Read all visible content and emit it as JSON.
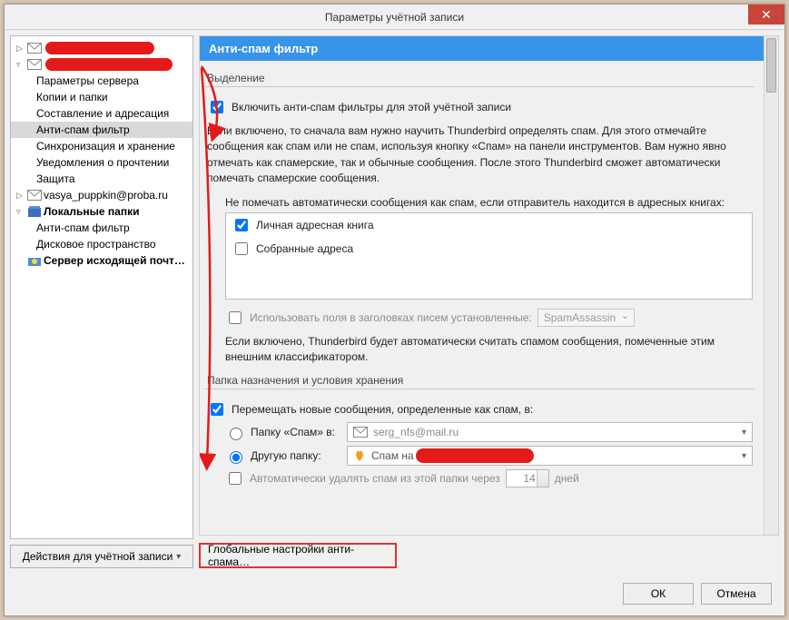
{
  "window": {
    "title": "Параметры учётной записи"
  },
  "tree": {
    "account1": "",
    "account2": "",
    "items1": [
      "Параметры сервера",
      "Копии и папки",
      "Составление и адресация",
      "Анти-спам фильтр",
      "Синхронизация и хранение",
      "Уведомления о прочтении",
      "Защита"
    ],
    "account3": "vasya_puppkin@proba.ru",
    "local": "Локальные папки",
    "items_local": [
      "Анти-спам фильтр",
      "Дисковое пространство"
    ],
    "smtp": "Сервер исходящей почт…"
  },
  "actions_button": "Действия для учётной записи",
  "panel": {
    "header": "Анти-спам фильтр",
    "group1": "Выделение",
    "enable": "Включить анти-спам фильтры для этой учётной записи",
    "desc1": "Если включено, то сначала вам нужно научить Thunderbird определять спам. Для этого отмечайте сообщения как спам или не спам, используя кнопку «Спам» на панели инструментов. Вам нужно явно отмечать как спамерские, так и обычные сообщения. После этого Thunderbird сможет автоматически помечать спамерские сообщения.",
    "not_mark_label": "Не помечать автоматически сообщения как спам, если отправитель находится в адресных книгах:",
    "ab1": "Личная адресная книга",
    "ab2": "Собранные адреса",
    "use_headers": "Использовать поля в заголовках писем установленные:",
    "classifier": "SpamAssassin",
    "desc2": "Если включено, Thunderbird будет автоматически считать спамом сообщения, помеченные этим внешним классификатором.",
    "group2": "Папка назначения и условия хранения",
    "move": "Перемещать новые сообщения, определенные как спам, в:",
    "opt1_label": "Папку «Спам» в:",
    "opt1_account": "serg_nfs@mail.ru",
    "opt2_label": "Другую папку:",
    "opt2_folder": "Спам на",
    "auto_delete": "Автоматически удалять спам из этой папки через",
    "days_value": "14",
    "days_label": "дней",
    "global_btn": "Глобальные настройки анти-спама…"
  },
  "footer": {
    "ok": "ОК",
    "cancel": "Отмена"
  }
}
